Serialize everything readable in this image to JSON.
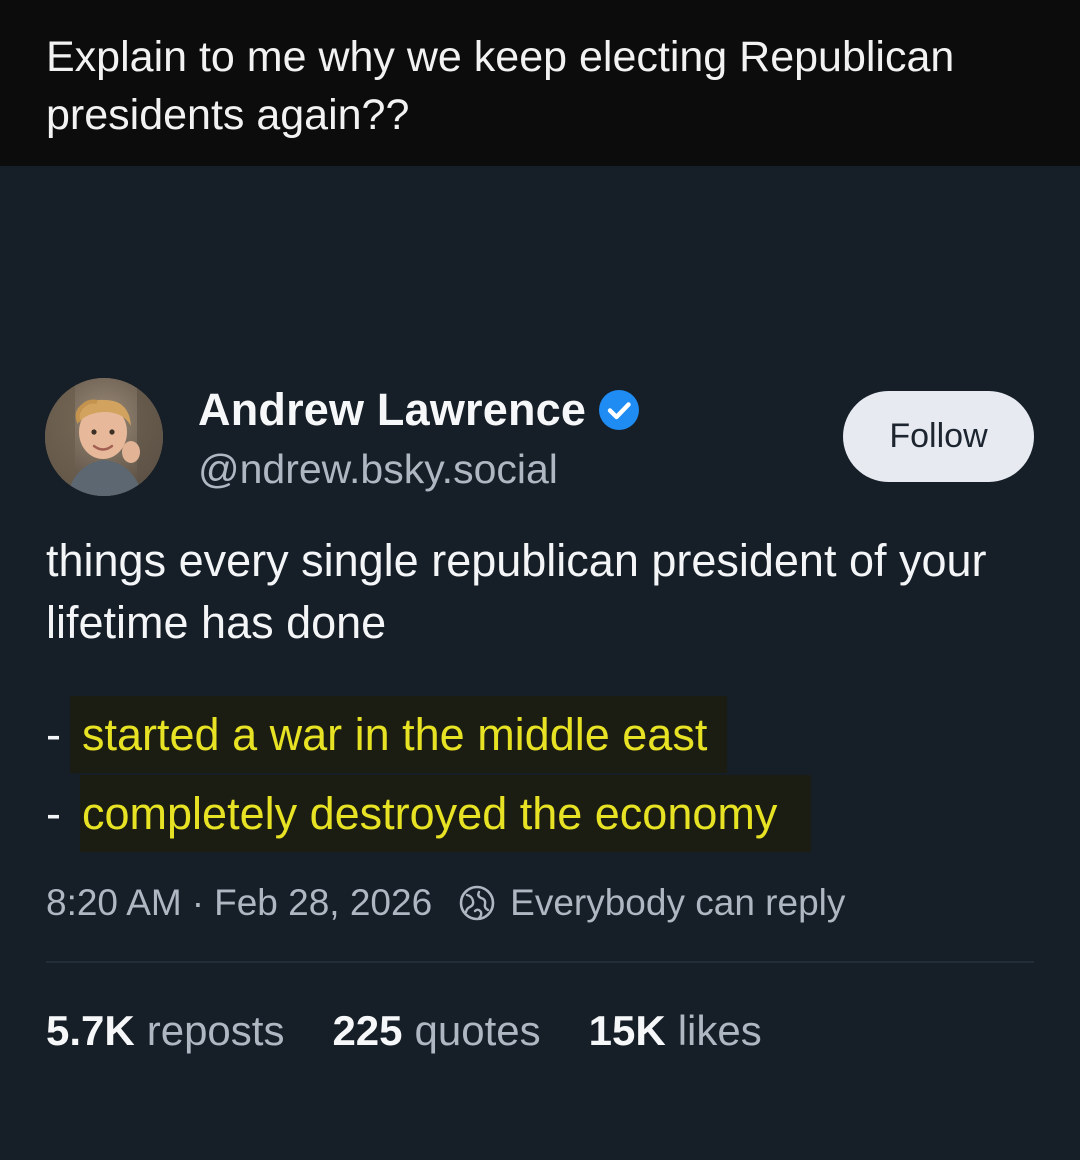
{
  "caption": {
    "text": "Explain to me why we keep electing Republican presidents again??"
  },
  "author": {
    "display_name": "Andrew Lawrence",
    "handle": "@ndrew.bsky.social",
    "verified": true
  },
  "follow_label": "Follow",
  "post": {
    "intro": "things every single republican president of your lifetime has done",
    "list_items": [
      {
        "dash": "-",
        "text": "started a war in the middle east"
      },
      {
        "dash": "-",
        "text": "completely destroyed the economy"
      }
    ],
    "time": "8:20 AM",
    "separator": "·",
    "date": "Feb 28, 2026",
    "reply_setting": "Everybody can reply"
  },
  "stats": {
    "reposts_count": "5.7K",
    "reposts_label": "reposts",
    "quotes_count": "225",
    "quotes_label": "quotes",
    "likes_count": "15K",
    "likes_label": "likes"
  },
  "colors": {
    "caption_bg": "#0c0c0c",
    "post_bg": "#161e27",
    "highlight_bg": "#1b1d12",
    "highlight_text": "#e7e224",
    "verified_blue": "#1f8cf4",
    "follow_bg": "#e7ebf1"
  },
  "icons": {
    "verified": "verified-check-icon",
    "reply_setting": "globe-icon"
  }
}
